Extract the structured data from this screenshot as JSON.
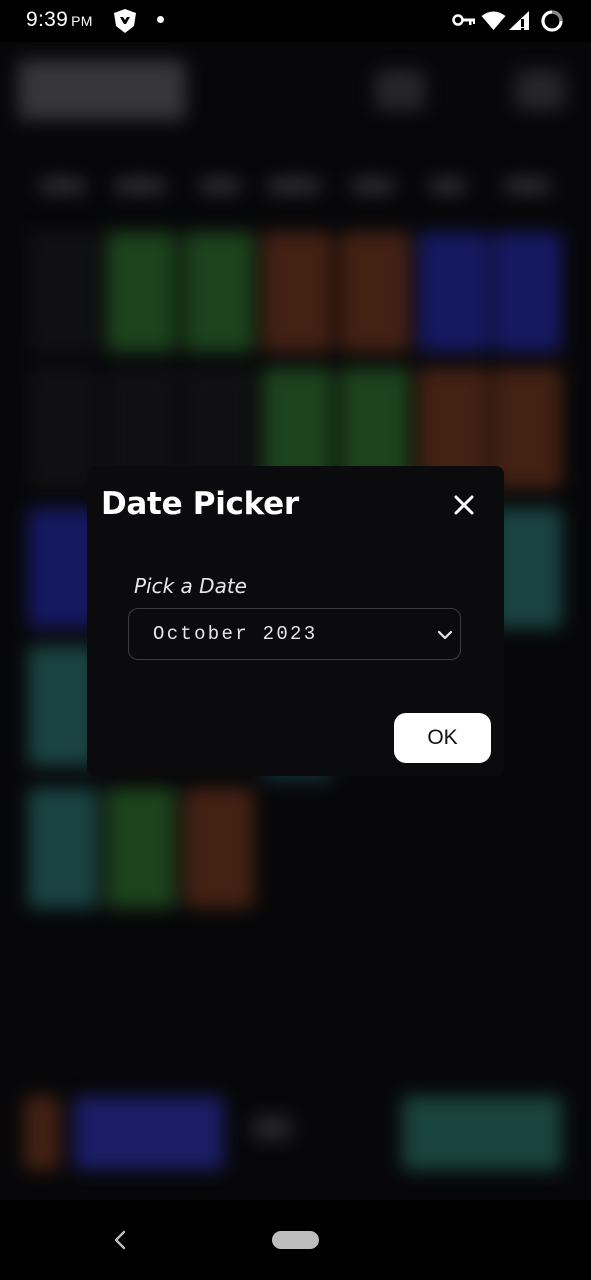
{
  "status_bar": {
    "time": "9:39",
    "ampm": "PM",
    "icons": [
      "shield-app-icon",
      "notification-dot-icon",
      "vpn-key-icon",
      "wifi-icon",
      "cellular-signal-icon",
      "battery-charging-icon"
    ]
  },
  "dialog": {
    "title": "Date Picker",
    "close_icon": "close-icon",
    "field_label": "Pick a Date",
    "selected_value": "October 2023",
    "dropdown_icon": "chevron-down-icon",
    "ok_label": "OK"
  },
  "nav_bar": {
    "icons": [
      "back-icon",
      "home-pill"
    ]
  },
  "colors": {
    "dialog_background": "#0b0b0d",
    "ok_button_background": "#ffffff",
    "select_border": "#3c3c40",
    "status_bar_background": "#000000"
  }
}
